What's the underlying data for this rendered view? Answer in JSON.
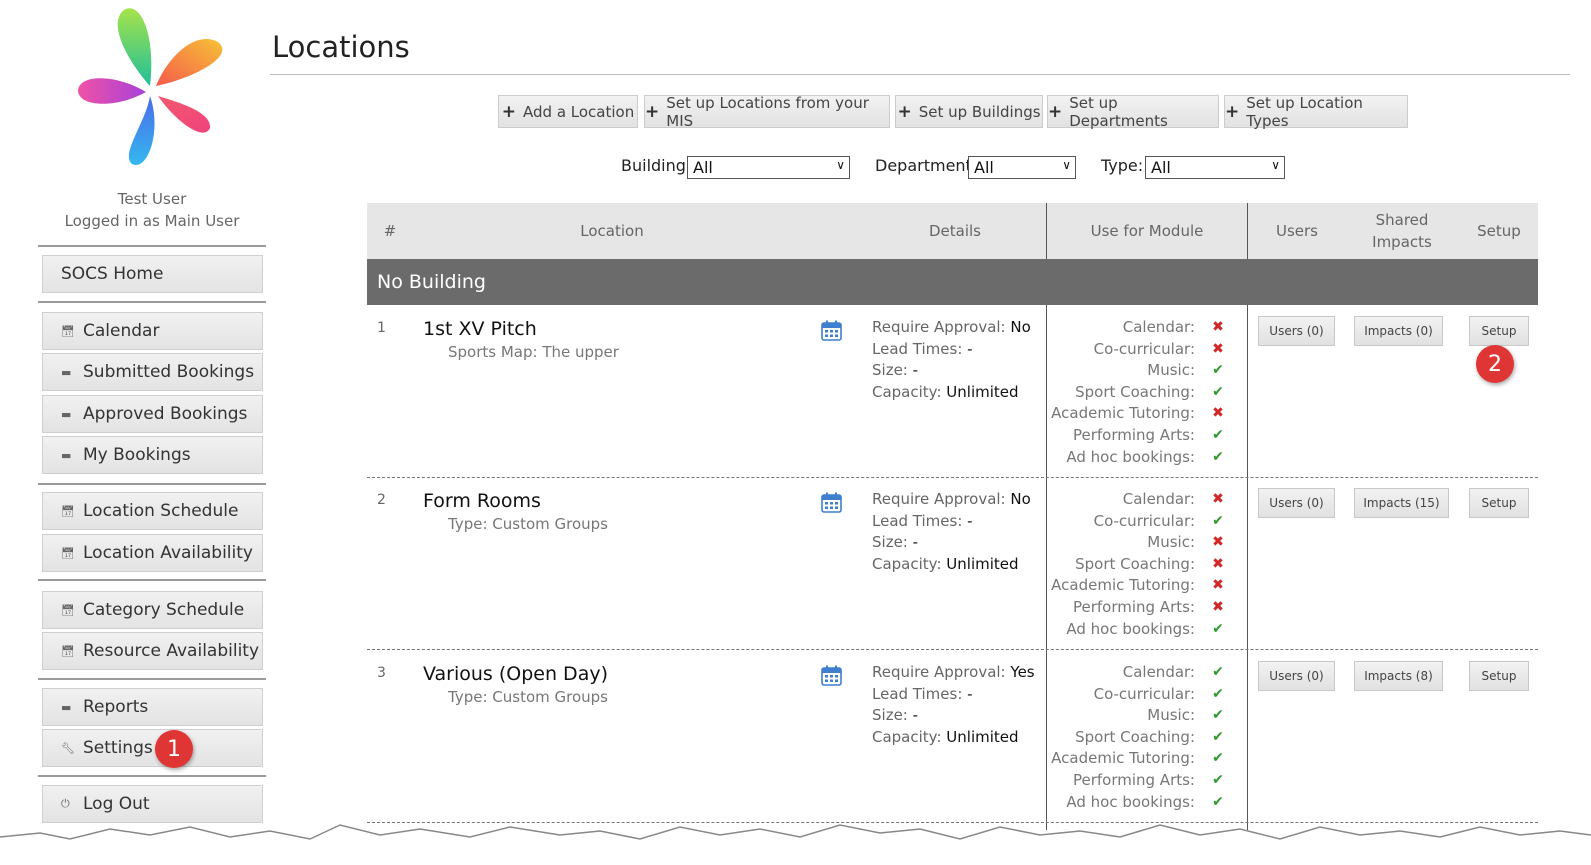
{
  "user": {
    "name": "Test User",
    "login_info": "Logged in as Main User"
  },
  "sidebar": {
    "home": "SOCS Home",
    "items": [
      {
        "label": "Calendar",
        "icon": "calendar-icon"
      },
      {
        "label": "Submitted Bookings",
        "icon": "folder-icon"
      },
      {
        "label": "Approved Bookings",
        "icon": "folder-icon"
      },
      {
        "label": "My Bookings",
        "icon": "folder-icon"
      },
      {
        "label": "Location Schedule",
        "icon": "calendar-icon"
      },
      {
        "label": "Location Availability",
        "icon": "calendar-icon"
      },
      {
        "label": "Category Schedule",
        "icon": "calendar-icon"
      },
      {
        "label": "Resource Availability",
        "icon": "calendar-icon"
      },
      {
        "label": "Reports",
        "icon": "folder-icon"
      },
      {
        "label": "Settings",
        "icon": "wrench-icon"
      },
      {
        "label": "Log Out",
        "icon": "power-icon"
      }
    ]
  },
  "page": {
    "title": "Locations"
  },
  "toolbar": {
    "add_location": "Add a Location",
    "setup_from_mis": "Set up Locations from your MIS",
    "setup_buildings": "Set up Buildings",
    "setup_departments": "Set up Departments",
    "setup_location_types": "Set up Location Types"
  },
  "filters": {
    "building_label": "Building:",
    "building_value": "All",
    "department_label": "Department:",
    "department_value": "All",
    "type_label": "Type:",
    "type_value": "All"
  },
  "table": {
    "headers": {
      "num": "#",
      "location": "Location",
      "details": "Details",
      "module": "Use for Module",
      "users": "Users",
      "shared": "Shared Impacts",
      "setup": "Setup"
    },
    "group": "No Building",
    "detail_labels": {
      "approval": "Require Approval:",
      "lead": "Lead Times:",
      "size": "Size:",
      "capacity": "Capacity:"
    },
    "module_labels": [
      "Calendar:",
      "Co-curricular:",
      "Music:",
      "Sport Coaching:",
      "Academic Tutoring:",
      "Performing Arts:",
      "Ad hoc bookings:"
    ],
    "rows": [
      {
        "num": "1",
        "name": "1st XV Pitch",
        "sub": "Sports Map: The upper",
        "approval": "No",
        "lead": "-",
        "size": "-",
        "capacity": "Unlimited",
        "modules": [
          false,
          false,
          true,
          true,
          false,
          true,
          true
        ],
        "users": "Users (0)",
        "impacts": "Impacts (0)",
        "setup": "Setup"
      },
      {
        "num": "2",
        "name": "Form Rooms",
        "sub": "Type: Custom Groups",
        "approval": "No",
        "lead": "-",
        "size": "-",
        "capacity": "Unlimited",
        "modules": [
          false,
          true,
          false,
          false,
          false,
          false,
          true
        ],
        "users": "Users (0)",
        "impacts": "Impacts (15)",
        "setup": "Setup"
      },
      {
        "num": "3",
        "name": "Various (Open Day)",
        "sub": "Type: Custom Groups",
        "approval": "Yes",
        "lead": "-",
        "size": "-",
        "capacity": "Unlimited",
        "modules": [
          true,
          true,
          true,
          true,
          true,
          true,
          true
        ],
        "users": "Users (0)",
        "impacts": "Impacts (8)",
        "setup": "Setup"
      }
    ]
  },
  "annotations": {
    "badge1": "1",
    "badge2": "2"
  },
  "colors": {
    "check": "#2e9a2e",
    "cross": "#d42626",
    "badge": "#e03535",
    "group_bar": "#6b6b6b"
  }
}
